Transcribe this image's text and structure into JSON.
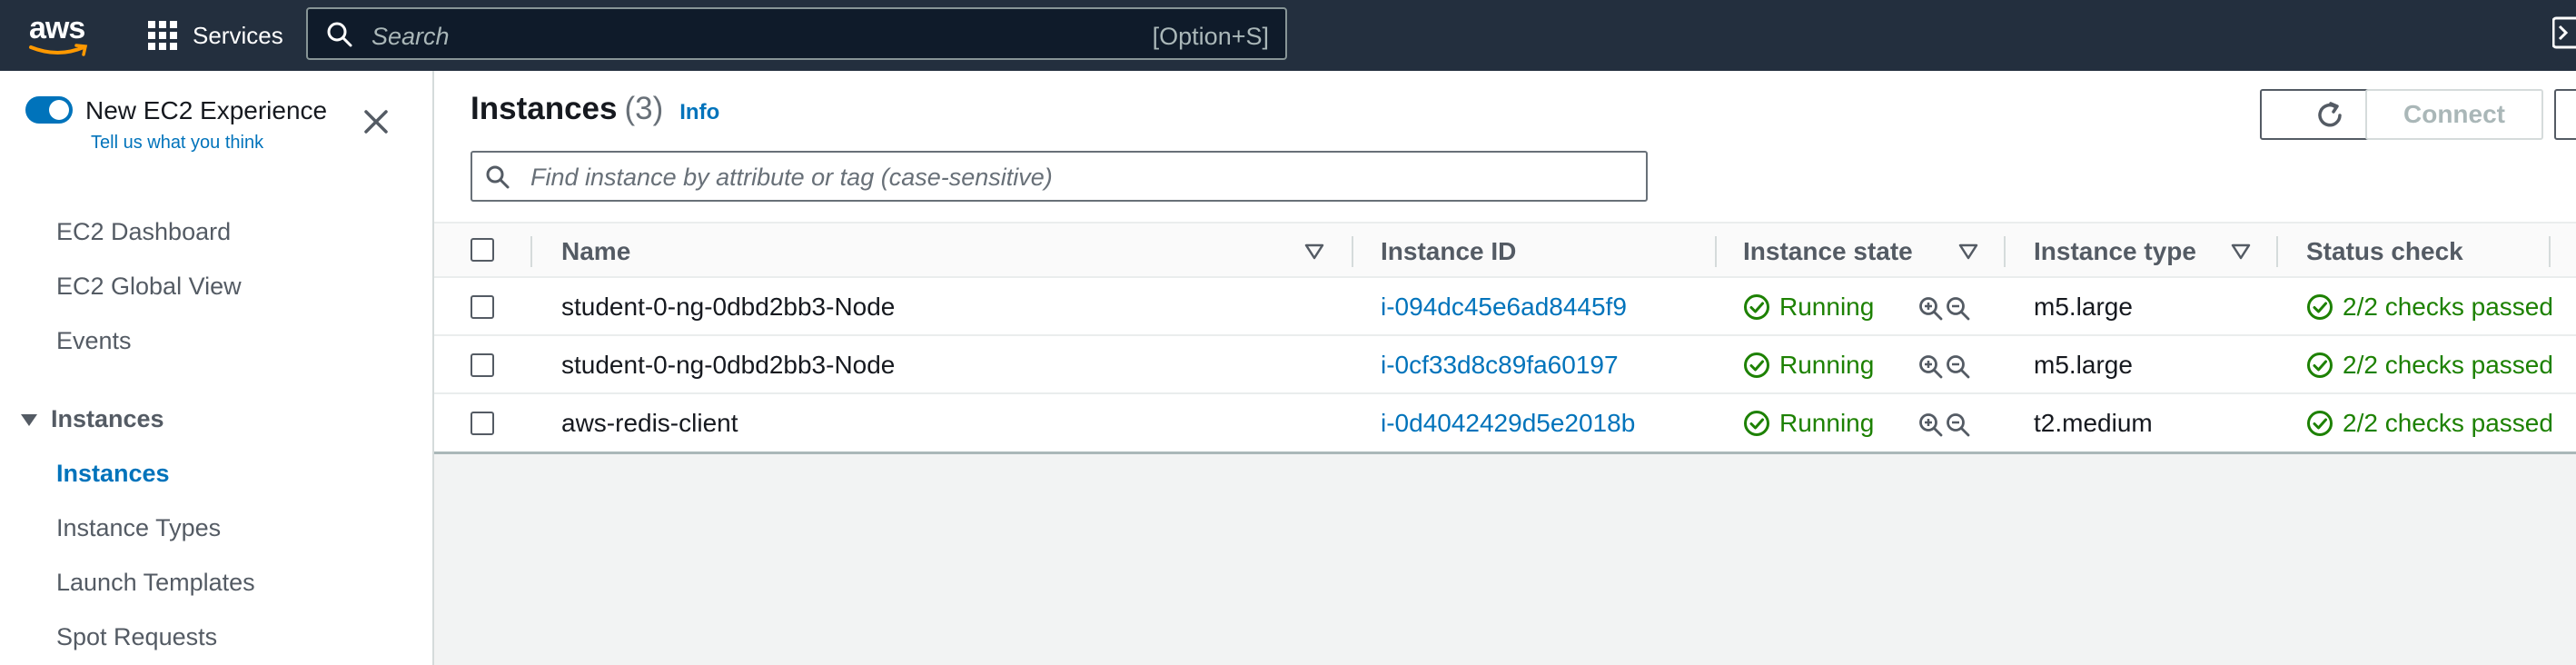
{
  "topnav": {
    "logo_text": "aws",
    "services_label": "Services",
    "search_placeholder": "Search",
    "search_shortcut": "[Option+S]"
  },
  "sidebar": {
    "new_experience_label": "New EC2 Experience",
    "tell_us_link": "Tell us what you think",
    "items": [
      {
        "label": "EC2 Dashboard"
      },
      {
        "label": "EC2 Global View"
      },
      {
        "label": "Events"
      }
    ],
    "section": {
      "label": "Instances",
      "items": [
        {
          "label": "Instances",
          "active": true
        },
        {
          "label": "Instance Types"
        },
        {
          "label": "Launch Templates"
        },
        {
          "label": "Spot Requests"
        }
      ]
    }
  },
  "main": {
    "title": "Instances",
    "count": "(3)",
    "info_link": "Info",
    "connect_label": "Connect",
    "filter_placeholder": "Find instance by attribute or tag (case-sensitive)",
    "columns": [
      "Name",
      "Instance ID",
      "Instance state",
      "Instance type",
      "Status check"
    ],
    "rows": [
      {
        "name": "student-0-ng-0dbd2bb3-Node",
        "id": "i-094dc45e6ad8445f9",
        "state": "Running",
        "type": "m5.large",
        "status": "2/2 checks passed"
      },
      {
        "name": "student-0-ng-0dbd2bb3-Node",
        "id": "i-0cf33d8c89fa60197",
        "state": "Running",
        "type": "m5.large",
        "status": "2/2 checks passed"
      },
      {
        "name": "aws-redis-client",
        "id": "i-0d4042429d5e2018b",
        "state": "Running",
        "type": "t2.medium",
        "status": "2/2 checks passed"
      }
    ]
  },
  "colors": {
    "nav_bg": "#232f3e",
    "link": "#0073bb",
    "success": "#1d8102",
    "accent": "#ff9900"
  }
}
